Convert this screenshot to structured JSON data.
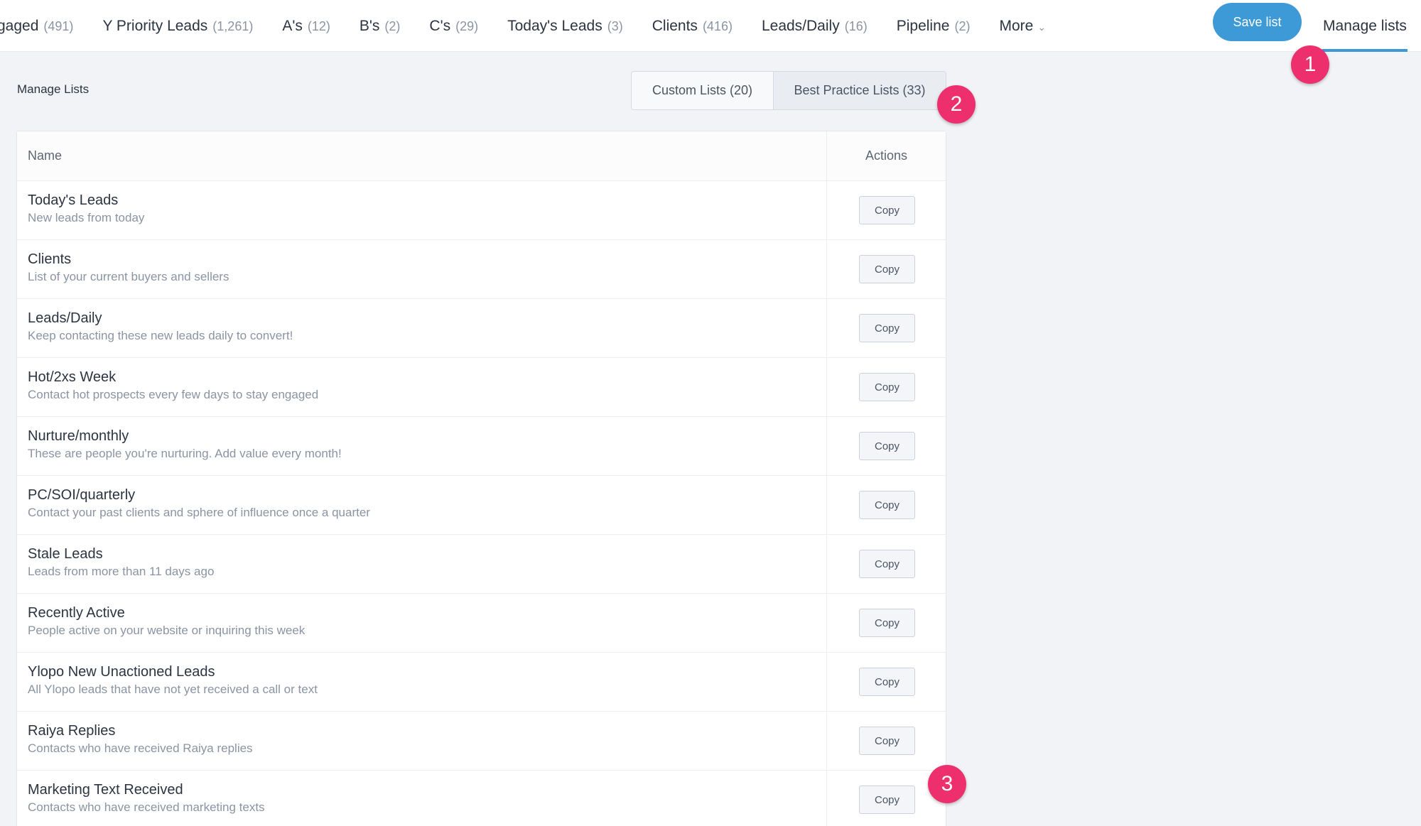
{
  "nav": {
    "tabs": [
      {
        "label": "gaged",
        "count": "(491)"
      },
      {
        "label": "Y Priority Leads",
        "count": "(1,261)"
      },
      {
        "label": "A's",
        "count": "(12)"
      },
      {
        "label": "B's",
        "count": "(2)"
      },
      {
        "label": "C's",
        "count": "(29)"
      },
      {
        "label": "Today's Leads",
        "count": "(3)"
      },
      {
        "label": "Clients",
        "count": "(416)"
      },
      {
        "label": "Leads/Daily",
        "count": "(16)"
      },
      {
        "label": "Pipeline",
        "count": "(2)"
      }
    ],
    "more_label": "More",
    "save_label": "Save list",
    "manage_label": "Manage lists"
  },
  "section": {
    "title": "Manage Lists",
    "toggle": {
      "custom": "Custom Lists (20)",
      "best": "Best Practice Lists (33)",
      "active": "best"
    }
  },
  "table": {
    "headers": {
      "name": "Name",
      "actions": "Actions"
    },
    "copy_label": "Copy",
    "rows": [
      {
        "title": "Today's Leads",
        "desc": "New leads from today"
      },
      {
        "title": "Clients",
        "desc": "List of your current buyers and sellers"
      },
      {
        "title": "Leads/Daily",
        "desc": "Keep contacting these new leads daily to convert!"
      },
      {
        "title": "Hot/2xs Week",
        "desc": "Contact hot prospects every few days to stay engaged"
      },
      {
        "title": "Nurture/monthly",
        "desc": "These are people you're nurturing. Add value every month!"
      },
      {
        "title": "PC/SOI/quarterly",
        "desc": "Contact your past clients and sphere of influence once a quarter"
      },
      {
        "title": "Stale Leads",
        "desc": "Leads from more than 11 days ago"
      },
      {
        "title": "Recently Active",
        "desc": "People active on your website or inquiring this week"
      },
      {
        "title": "Ylopo New Unactioned Leads",
        "desc": "All Ylopo leads that have not yet received a call or text"
      },
      {
        "title": "Raiya Replies",
        "desc": "Contacts who have received Raiya replies"
      },
      {
        "title": "Marketing Text Received",
        "desc": "Contacts who have received marketing texts"
      }
    ]
  },
  "markers": [
    "1",
    "2",
    "3"
  ],
  "colors": {
    "accent": "#3d9ad6",
    "marker": "#ee2f6e",
    "background": "#f1f3f7"
  }
}
